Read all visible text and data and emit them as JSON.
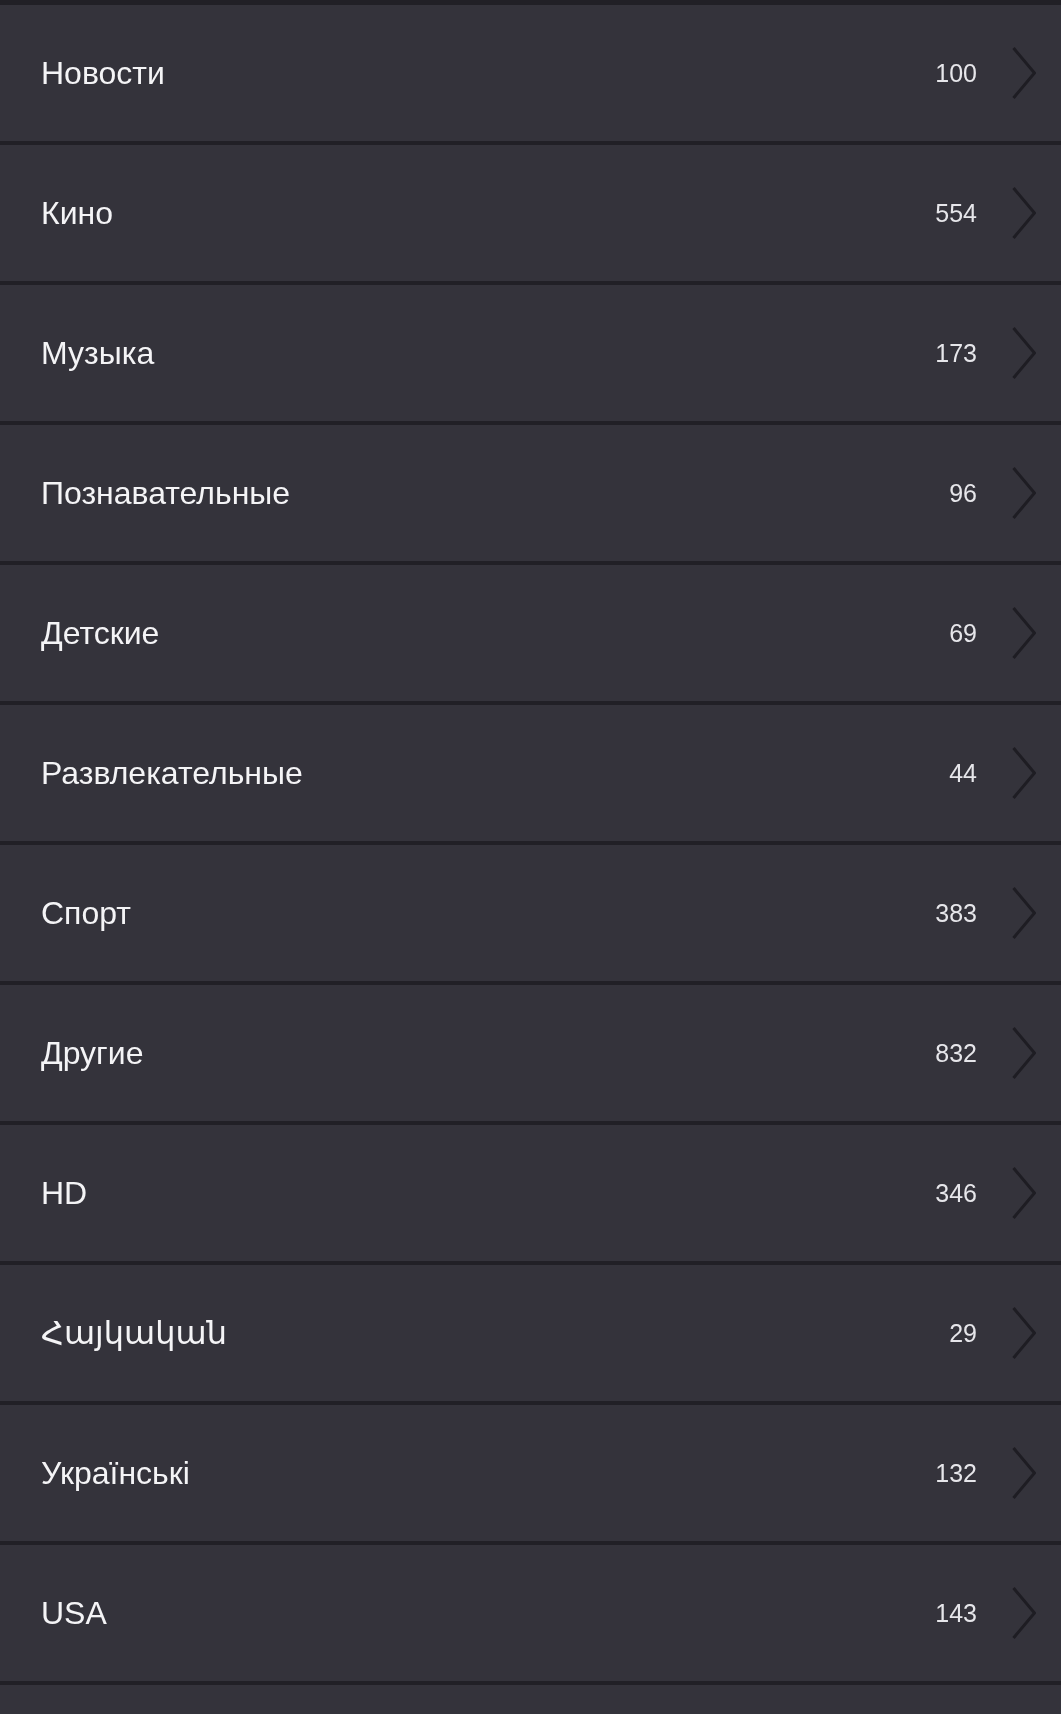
{
  "categories": [
    {
      "name": "Новости",
      "count": "100"
    },
    {
      "name": "Кино",
      "count": "554"
    },
    {
      "name": "Музыка",
      "count": "173"
    },
    {
      "name": "Познавательные",
      "count": "96"
    },
    {
      "name": "Детские",
      "count": "69"
    },
    {
      "name": "Развлекательные",
      "count": "44"
    },
    {
      "name": "Спорт",
      "count": "383"
    },
    {
      "name": "Другие",
      "count": "832"
    },
    {
      "name": "HD",
      "count": "346"
    },
    {
      "name": "Հայկական",
      "count": "29"
    },
    {
      "name": "Українські",
      "count": "132"
    },
    {
      "name": "USA",
      "count": "143"
    }
  ]
}
